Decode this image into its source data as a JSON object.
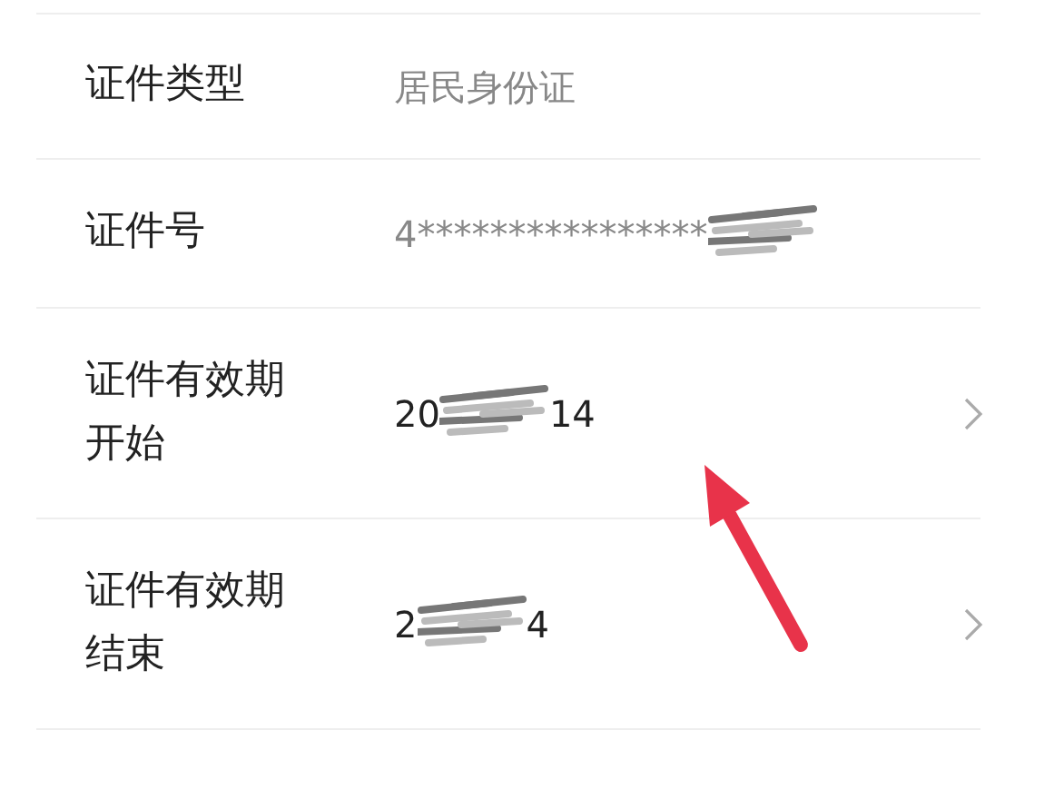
{
  "rows": [
    {
      "label": "证件类型",
      "value_parts": [
        {
          "kind": "text",
          "text": "居民身份证"
        }
      ],
      "muted": true,
      "chevron": false
    },
    {
      "label": "证件号",
      "value_parts": [
        {
          "kind": "text",
          "text": "4****************"
        },
        {
          "kind": "redaction"
        }
      ],
      "muted": true,
      "chevron": false
    },
    {
      "label": "证件有效期开始",
      "value_parts": [
        {
          "kind": "text",
          "text": "20"
        },
        {
          "kind": "redaction"
        },
        {
          "kind": "text",
          "text": "14"
        }
      ],
      "muted": false,
      "chevron": true
    },
    {
      "label": "证件有效期结束",
      "value_parts": [
        {
          "kind": "text",
          "text": "2"
        },
        {
          "kind": "redaction"
        },
        {
          "kind": "text",
          "text": "4"
        }
      ],
      "muted": false,
      "chevron": true
    }
  ],
  "annotation": {
    "kind": "arrow",
    "color": "#e8334a"
  }
}
